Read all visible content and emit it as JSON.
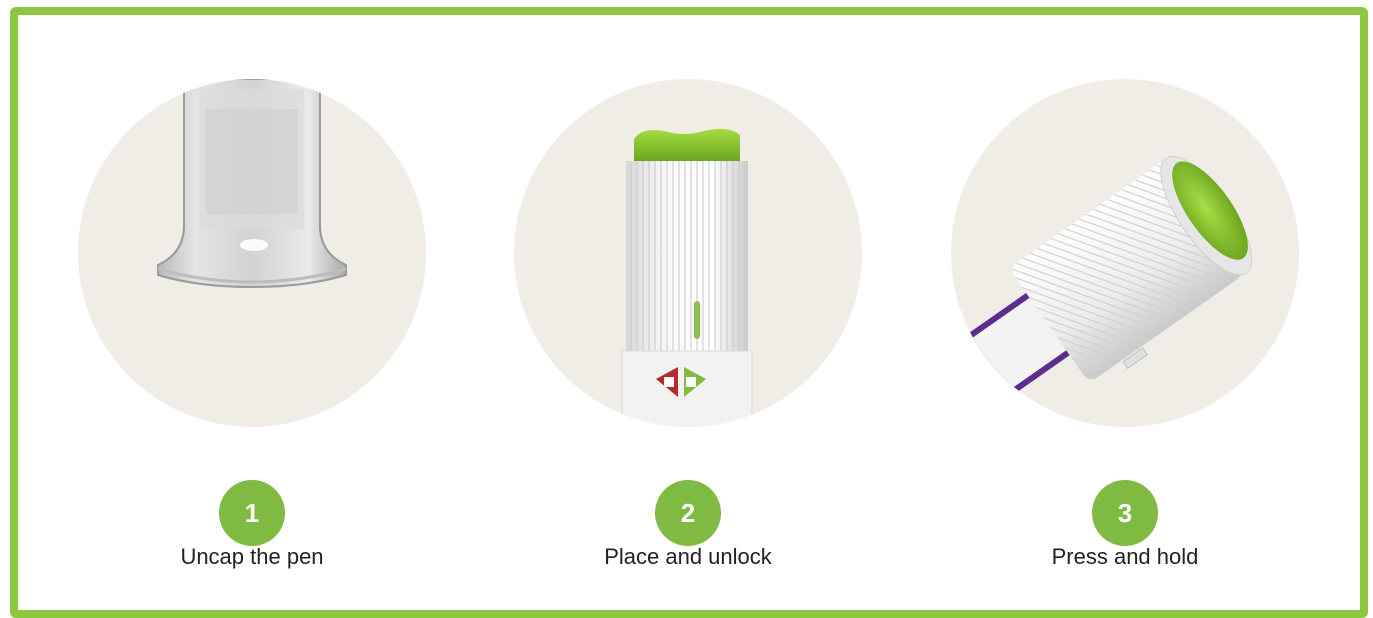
{
  "colors": {
    "border": "#8dc63f",
    "badge": "#7fba42",
    "circle_bg": "#efede6",
    "lock_red": "#b52a2a",
    "unlock_green": "#7fba42"
  },
  "steps": [
    {
      "number": "1",
      "label": "Uncap the pen",
      "icon": "pen-cap-illustration"
    },
    {
      "number": "2",
      "label": "Place and unlock",
      "icon": "pen-unlock-illustration"
    },
    {
      "number": "3",
      "label": "Press and hold",
      "icon": "pen-press-illustration"
    }
  ]
}
